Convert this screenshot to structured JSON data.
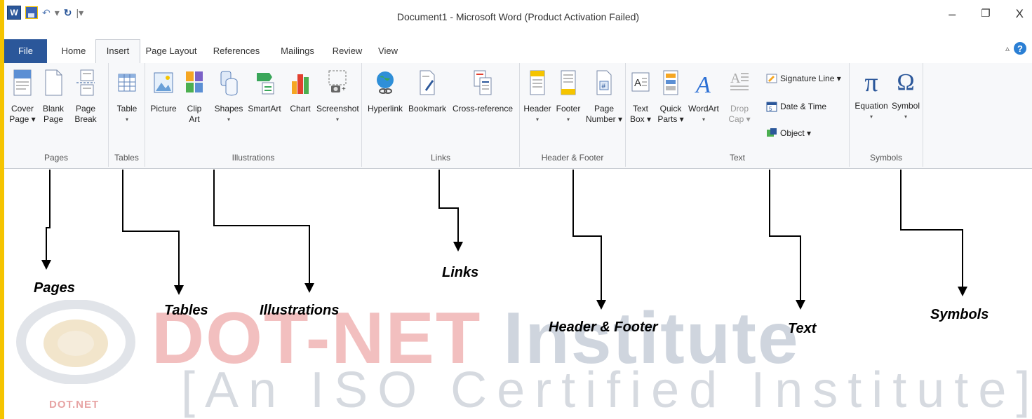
{
  "titlebar": {
    "title": "Document1 - Microsoft Word (Product Activation Failed)",
    "app_icon_letter": "W",
    "minimize": "–",
    "restore": "❐",
    "close": "X"
  },
  "tabs": [
    "File",
    "Home",
    "Insert",
    "Page Layout",
    "References",
    "Mailings",
    "Review",
    "View"
  ],
  "active_tab": "Insert",
  "colors": {
    "file_tab": "#2b579a",
    "accent_yellow": "#f5c400",
    "watermark_red": "#e98b8b"
  },
  "groups": {
    "pages": {
      "label": "Pages",
      "buttons": [
        {
          "label": "Cover\nPage ▾",
          "icon": "cover-page-icon"
        },
        {
          "label": "Blank\nPage",
          "icon": "blank-page-icon"
        },
        {
          "label": "Page\nBreak",
          "icon": "page-break-icon"
        }
      ]
    },
    "tables": {
      "label": "Tables",
      "buttons": [
        {
          "label": "Table",
          "icon": "table-icon",
          "dropdown": "▾"
        }
      ]
    },
    "illustrations": {
      "label": "Illustrations",
      "buttons": [
        {
          "label": "Picture",
          "icon": "picture-icon"
        },
        {
          "label": "Clip\nArt",
          "icon": "clip-art-icon"
        },
        {
          "label": "Shapes",
          "icon": "shapes-icon",
          "dropdown": "▾"
        },
        {
          "label": "SmartArt",
          "icon": "smartart-icon"
        },
        {
          "label": "Chart",
          "icon": "chart-icon"
        },
        {
          "label": "Screenshot",
          "icon": "screenshot-icon",
          "dropdown": "▾"
        }
      ]
    },
    "links": {
      "label": "Links",
      "buttons": [
        {
          "label": "Hyperlink",
          "icon": "hyperlink-icon"
        },
        {
          "label": "Bookmark",
          "icon": "bookmark-icon"
        },
        {
          "label": "Cross-reference",
          "icon": "cross-reference-icon"
        }
      ]
    },
    "header_footer": {
      "label": "Header & Footer",
      "buttons": [
        {
          "label": "Header",
          "icon": "header-icon",
          "dropdown": "▾"
        },
        {
          "label": "Footer",
          "icon": "footer-icon",
          "dropdown": "▾"
        },
        {
          "label": "Page\nNumber ▾",
          "icon": "page-number-icon"
        }
      ]
    },
    "text": {
      "label": "Text",
      "buttons": [
        {
          "label": "Text\nBox ▾",
          "icon": "text-box-icon"
        },
        {
          "label": "Quick\nParts ▾",
          "icon": "quick-parts-icon"
        },
        {
          "label": "WordArt",
          "icon": "wordart-icon",
          "dropdown": "▾"
        },
        {
          "label": "Drop\nCap ▾",
          "icon": "drop-cap-icon"
        }
      ],
      "small_buttons": [
        {
          "label": "Signature Line ▾",
          "icon": "signature-line-icon"
        },
        {
          "label": "Date & Time",
          "icon": "date-time-icon"
        },
        {
          "label": "Object ▾",
          "icon": "object-icon"
        }
      ]
    },
    "symbols": {
      "label": "Symbols",
      "buttons": [
        {
          "label": "Equation",
          "icon": "equation-icon",
          "dropdown": "▾",
          "glyph": "π"
        },
        {
          "label": "Symbol",
          "icon": "symbol-icon",
          "dropdown": "▾",
          "glyph": "Ω"
        }
      ]
    }
  },
  "callouts": {
    "pages": "Pages",
    "tables": "Tables",
    "illustrations": "Illustrations",
    "links": "Links",
    "header_footer": "Header & Footer",
    "text": "Text",
    "symbols": "Symbols"
  },
  "watermark": {
    "main_left": "DOT-NET",
    "main_right": "Institute",
    "sub": "[An ISO Certified Institute]",
    "logo_text": "DOT.NET"
  }
}
